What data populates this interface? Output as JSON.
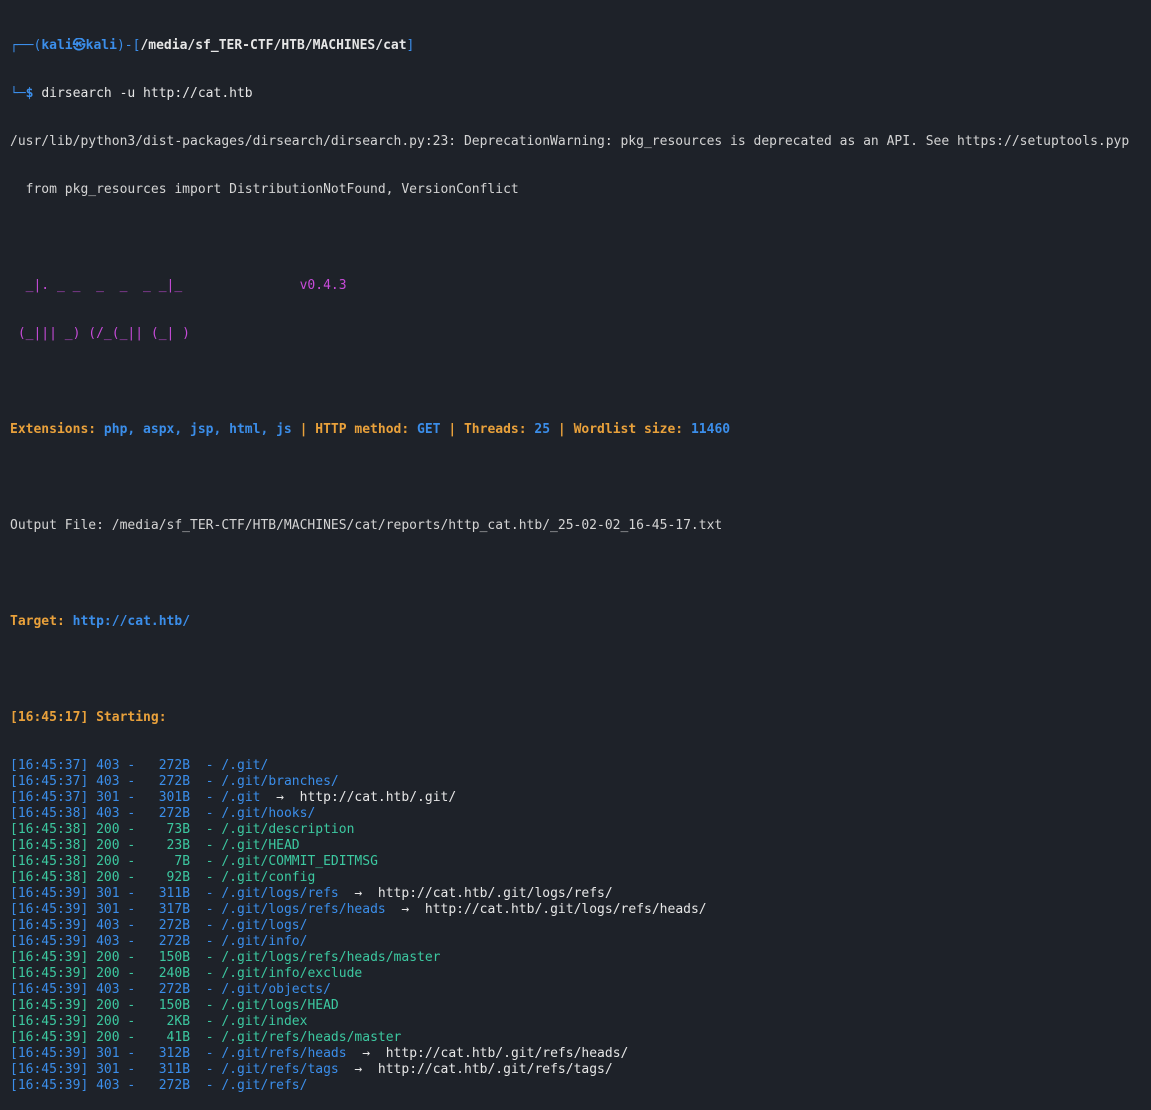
{
  "prompt": {
    "user": "kali",
    "at": "㉿",
    "host": "kali",
    "path": "/media/sf_TER-CTF/HTB/MACHINES/cat",
    "command": "dirsearch -u http://cat.htb"
  },
  "warning": {
    "line1": "/usr/lib/python3/dist-packages/dirsearch/dirsearch.py:23: DeprecationWarning: pkg_resources is deprecated as an API. See https://setuptools.pyp",
    "line2": "  from pkg_resources import DistributionNotFound, VersionConflict"
  },
  "banner": {
    "art1": "  _|. _ _  _  _  _ _|_",
    "art2": " (_||| _) (/_(_|| (_| )",
    "version": "v0.4.3"
  },
  "config": {
    "ext_label": "Extensions:",
    "ext_value": "php, aspx, jsp, html, js",
    "method_label": "HTTP method:",
    "method_value": "GET",
    "threads_label": "Threads:",
    "threads_value": "25",
    "wordlist_label": "Wordlist size:",
    "wordlist_value": "11460",
    "sep": "|"
  },
  "output_file": "Output File: /media/sf_TER-CTF/HTB/MACHINES/cat/reports/http_cat.htb/_25-02-02_16-45-17.txt",
  "target": {
    "label": "Target:",
    "value": "http://cat.htb/"
  },
  "starting": "[16:45:17] Starting:",
  "results": [
    {
      "t": "[16:45:37]",
      "code": "403",
      "size": "  272B",
      "path": "/.git/",
      "redirect": ""
    },
    {
      "t": "[16:45:37]",
      "code": "403",
      "size": "  272B",
      "path": "/.git/branches/",
      "redirect": ""
    },
    {
      "t": "[16:45:37]",
      "code": "301",
      "size": "  301B",
      "path": "/.git",
      "redirect": "http://cat.htb/.git/"
    },
    {
      "t": "[16:45:38]",
      "code": "403",
      "size": "  272B",
      "path": "/.git/hooks/",
      "redirect": ""
    },
    {
      "t": "[16:45:38]",
      "code": "200",
      "size": "   73B",
      "path": "/.git/description",
      "redirect": ""
    },
    {
      "t": "[16:45:38]",
      "code": "200",
      "size": "   23B",
      "path": "/.git/HEAD",
      "redirect": ""
    },
    {
      "t": "[16:45:38]",
      "code": "200",
      "size": "    7B",
      "path": "/.git/COMMIT_EDITMSG",
      "redirect": ""
    },
    {
      "t": "[16:45:38]",
      "code": "200",
      "size": "   92B",
      "path": "/.git/config",
      "redirect": ""
    },
    {
      "t": "[16:45:39]",
      "code": "301",
      "size": "  311B",
      "path": "/.git/logs/refs",
      "redirect": "http://cat.htb/.git/logs/refs/"
    },
    {
      "t": "[16:45:39]",
      "code": "301",
      "size": "  317B",
      "path": "/.git/logs/refs/heads",
      "redirect": "http://cat.htb/.git/logs/refs/heads/"
    },
    {
      "t": "[16:45:39]",
      "code": "403",
      "size": "  272B",
      "path": "/.git/logs/",
      "redirect": ""
    },
    {
      "t": "[16:45:39]",
      "code": "403",
      "size": "  272B",
      "path": "/.git/info/",
      "redirect": ""
    },
    {
      "t": "[16:45:39]",
      "code": "200",
      "size": "  150B",
      "path": "/.git/logs/refs/heads/master",
      "redirect": ""
    },
    {
      "t": "[16:45:39]",
      "code": "200",
      "size": "  240B",
      "path": "/.git/info/exclude",
      "redirect": ""
    },
    {
      "t": "[16:45:39]",
      "code": "403",
      "size": "  272B",
      "path": "/.git/objects/",
      "redirect": ""
    },
    {
      "t": "[16:45:39]",
      "code": "200",
      "size": "  150B",
      "path": "/.git/logs/HEAD",
      "redirect": ""
    },
    {
      "t": "[16:45:39]",
      "code": "200",
      "size": "   2KB",
      "path": "/.git/index",
      "redirect": ""
    },
    {
      "t": "[16:45:39]",
      "code": "200",
      "size": "   41B",
      "path": "/.git/refs/heads/master",
      "redirect": ""
    },
    {
      "t": "[16:45:39]",
      "code": "301",
      "size": "  312B",
      "path": "/.git/refs/heads",
      "redirect": "http://cat.htb/.git/refs/heads/"
    },
    {
      "t": "[16:45:39]",
      "code": "301",
      "size": "  311B",
      "path": "/.git/refs/tags",
      "redirect": "http://cat.htb/.git/refs/tags/"
    },
    {
      "t": "[16:45:39]",
      "code": "403",
      "size": "  272B",
      "path": "/.git/refs/",
      "redirect": ""
    }
  ],
  "arrow": "→",
  "dash": "-"
}
